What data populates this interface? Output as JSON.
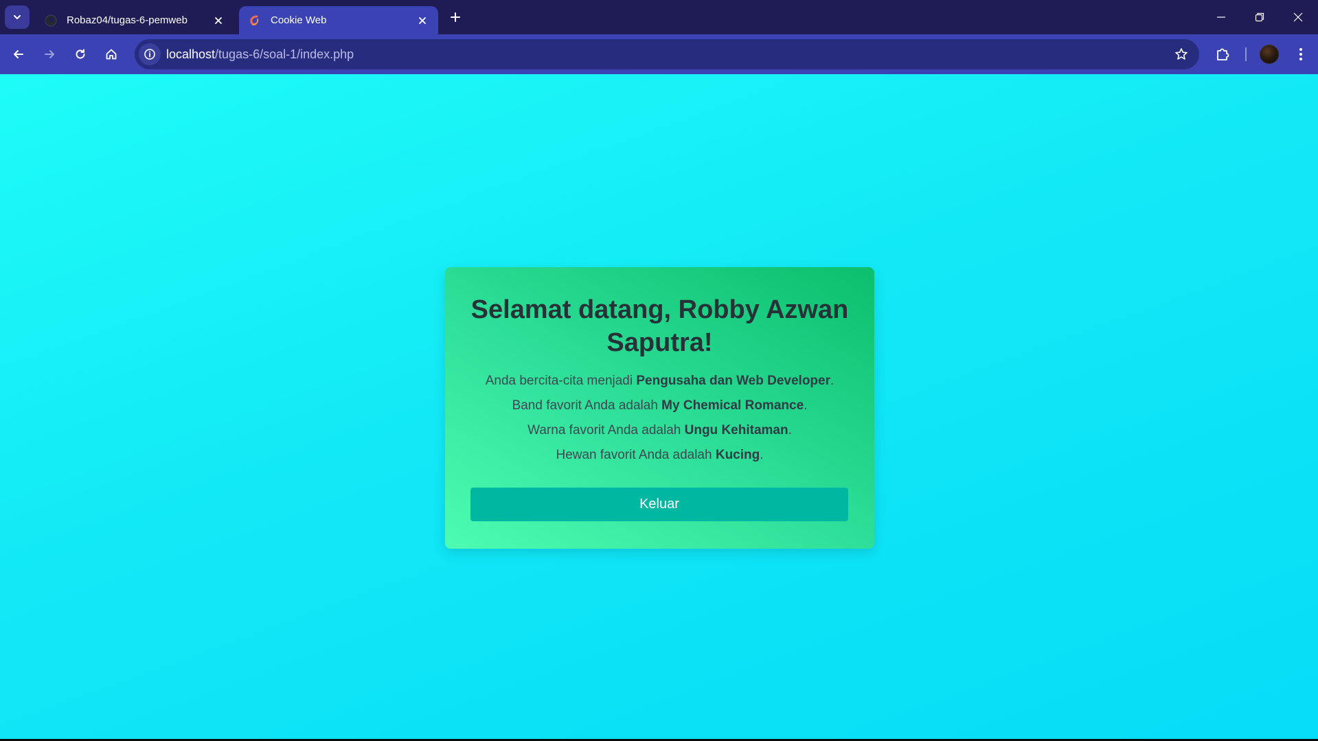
{
  "browser": {
    "tabs": [
      {
        "title": "Robaz04/tugas-6-pemweb",
        "favicon": "github-icon",
        "active": false
      },
      {
        "title": "Cookie Web",
        "favicon": "xampp-icon",
        "active": true
      }
    ],
    "address_bar": {
      "host": "localhost",
      "path": "/tugas-6/soal-1/index.php"
    },
    "icons": {
      "tab_search": "chevron-down-icon",
      "new_tab": "plus-icon",
      "back": "arrow-left-icon",
      "forward": "arrow-right-icon",
      "reload": "reload-icon",
      "home": "home-icon",
      "site_info": "info-icon",
      "bookmark": "star-icon",
      "extensions": "puzzle-icon",
      "menu": "kebab-menu-icon"
    },
    "colors": {
      "tabstrip": "#1e1b55",
      "toolbar": "#3b43b4",
      "omnibox": "#282c7e"
    }
  },
  "page": {
    "title": "Selamat datang, Robby Azwan Saputra!",
    "lines": [
      {
        "prefix": "Anda bercita-cita menjadi ",
        "value": "Pengusaha dan Web Developer",
        "suffix": "."
      },
      {
        "prefix": "Band favorit Anda adalah ",
        "value": "My Chemical Romance",
        "suffix": "."
      },
      {
        "prefix": "Warna favorit Anda adalah ",
        "value": "Ungu Kehitaman",
        "suffix": "."
      },
      {
        "prefix": "Hewan favorit Anda adalah ",
        "value": "Kucing",
        "suffix": "."
      }
    ],
    "logout_label": "Keluar",
    "colors": {
      "background": "#12e8f6",
      "card": "#2fe09a",
      "button": "#00b7a2",
      "title_text": "#263238"
    }
  }
}
